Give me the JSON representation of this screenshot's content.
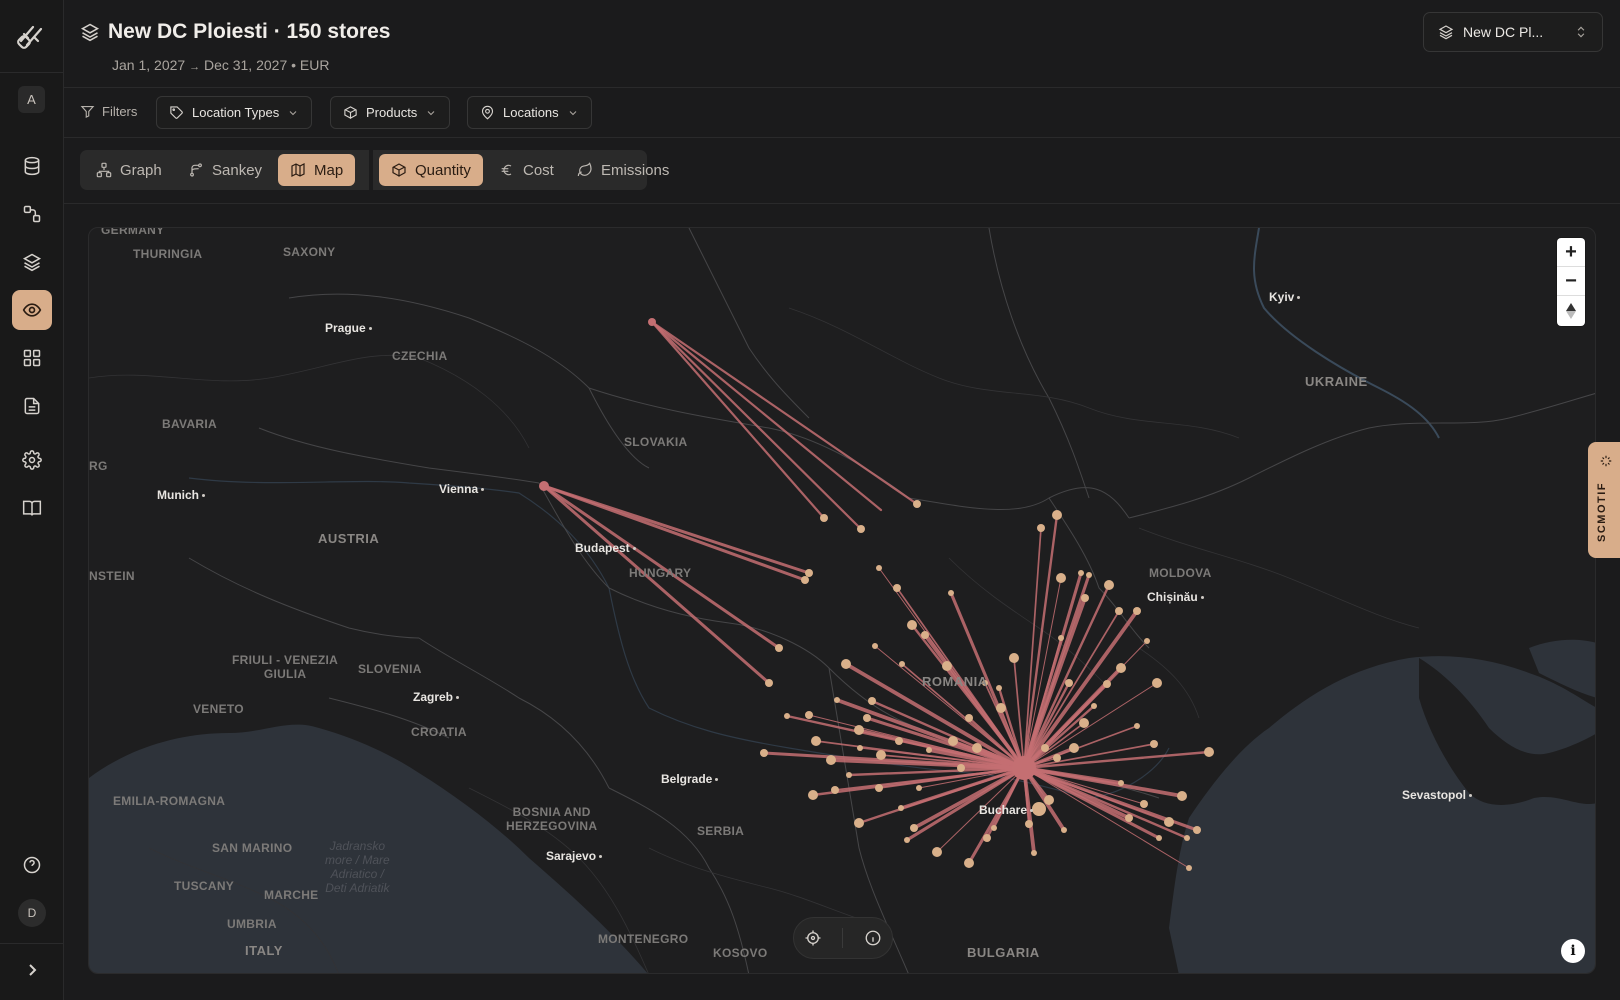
{
  "sidebar": {
    "workspace_initial": "A",
    "user_initial": "D",
    "items": [
      {
        "name": "database-icon"
      },
      {
        "name": "network-icon"
      },
      {
        "name": "layers-icon"
      },
      {
        "name": "eye-icon",
        "active": true
      },
      {
        "name": "dashboard-icon"
      },
      {
        "name": "document-icon"
      },
      {
        "name": "gear-icon"
      },
      {
        "name": "book-icon"
      }
    ]
  },
  "header": {
    "title": "New DC Ploiesti · 150 stores",
    "date_start": "Jan 1, 2027",
    "date_arrow": "→",
    "date_end": "Dec 31, 2027",
    "currency": "• EUR",
    "scenario_label": "New DC Pl..."
  },
  "filters": {
    "label": "Filters",
    "chips": [
      "Location Types",
      "Products",
      "Locations"
    ]
  },
  "views": {
    "tabs": [
      "Graph",
      "Sankey",
      "Map"
    ],
    "active": "Map",
    "metrics": [
      "Quantity",
      "Cost",
      "Emissions"
    ],
    "active_metric": "Quantity"
  },
  "map": {
    "labels": {
      "germany": "GERMANY",
      "thuringia": "THURINGIA",
      "saxony": "SAXONY",
      "prague": "Prague",
      "czechia": "CZECHIA",
      "bavaria": "BAVARIA",
      "rg": "RG",
      "munich": "Munich",
      "vienna": "Vienna",
      "austria": "AUSTRIA",
      "nstein": "NSTEIN",
      "slovakia": "SLOVAKIA",
      "budapest": "Budapest",
      "hungary": "HUNGARY",
      "friuli": "FRIULI - VENEZIA\nGIULIA",
      "slovenia": "SLOVENIA",
      "zagreb": "Zagreb",
      "veneto": "VENETO",
      "croatia": "CROATIA",
      "emilia": "EMILIA-ROMAGNA",
      "belgrade": "Belgrade",
      "bosnia": "BOSNIA AND\nHERZEGOVINA",
      "serbia": "SERBIA",
      "san_marino": "SAN MARINO",
      "sarajevo": "Sarajevo",
      "adriatic": "Jadransko\nmore / Mare\nAdriatico /\nDeti Adriatik",
      "tuscany": "TUSCANY",
      "marche": "MARCHE",
      "umbria": "UMBRIA",
      "italy": "ITALY",
      "montenegro": "MONTENEGRO",
      "kosovo": "KOSOVO",
      "bulgaria": "BULGARIA",
      "bucharest": "Buchare",
      "romania": "ROMANIA",
      "moldova": "MOLDOVA",
      "chisinau": "Chișinău",
      "kyiv": "Kyiv",
      "ukraine": "UKRAINE",
      "sevastopol": "Sevastopol"
    },
    "zoom_in": "+",
    "zoom_out": "−",
    "colors": {
      "flow": "#c46f72",
      "node": "#d9b08a",
      "sea": "#2e333a",
      "land": "#1e1e1f"
    }
  },
  "side_tab_label": "SCMOTIF"
}
